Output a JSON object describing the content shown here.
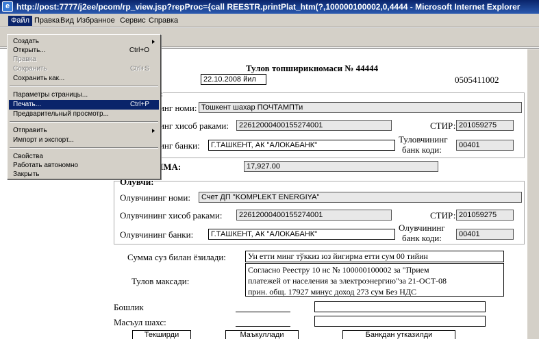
{
  "window": {
    "title": "http://post:7777/j2ee/pcom/rp_view.jsp?repProc={call REESTR.printPlat_htm(?,100000100002,0,4444 - Microsoft Internet Explorer",
    "icon": "ie-icon"
  },
  "menubar": [
    "Файл",
    "Правка",
    "Вид",
    "Избранное",
    "Сервис",
    "Справка"
  ],
  "file_menu": [
    {
      "label": "Создать",
      "shortcut": "",
      "submenu": true,
      "disabled": false
    },
    {
      "label": "Открыть...",
      "shortcut": "Ctrl+O",
      "submenu": false,
      "disabled": false
    },
    {
      "label": "Правка",
      "shortcut": "",
      "submenu": false,
      "disabled": true
    },
    {
      "label": "Сохранить",
      "shortcut": "Ctrl+S",
      "submenu": false,
      "disabled": true
    },
    {
      "label": "Сохранить как...",
      "shortcut": "",
      "submenu": false,
      "disabled": false
    },
    {
      "label": "Параметры страницы...",
      "shortcut": "",
      "submenu": false,
      "disabled": false
    },
    {
      "label": "Печать...",
      "shortcut": "Ctrl+P",
      "submenu": false,
      "disabled": false,
      "selected": true
    },
    {
      "label": "Предварительный просмотр...",
      "shortcut": "",
      "submenu": false,
      "disabled": false
    },
    {
      "label": "Отправить",
      "shortcut": "",
      "submenu": true,
      "disabled": false
    },
    {
      "label": "Импорт и экспорт...",
      "shortcut": "",
      "submenu": false,
      "disabled": false
    },
    {
      "label": "Свойства",
      "shortcut": "",
      "submenu": false,
      "disabled": false
    },
    {
      "label": "Работать автономно",
      "shortcut": "",
      "submenu": false,
      "disabled": false
    },
    {
      "label": "Закрыть",
      "shortcut": "",
      "submenu": false,
      "disabled": false
    }
  ],
  "doc": {
    "title": "Тулов топширикномаси № 44444",
    "date_tail": "а:",
    "date": "22.10.2008 йил",
    "code": "0505411002",
    "payer_head": "и:",
    "payer_name_lbl": "нинг номи:",
    "payer_name": "Тошкент шахар ПОЧТАМПТи",
    "payer_acc_lbl": "нинг хисоб раками:",
    "payer_acc": "22612000400155274001",
    "payer_inn_lbl": "СТИР:",
    "payer_inn": "201059275",
    "payer_bank_lbl": "нинг банки:",
    "payer_bank": "Г.ТАШКЕНТ, АК \"АЛОКАБАНК\"",
    "payer_bankcode_lbl1": "Туловчининг",
    "payer_bankcode_lbl2": "банк коди:",
    "payer_bankcode": "00401",
    "sum_lbl": "ММА:",
    "sum": "17,927.00",
    "recv_head": "Олувчи:",
    "recv_name_lbl": "Олувчининг номи:",
    "recv_name": "Счет ДП \"KOMPLEKT ENERGIYA\"",
    "recv_acc_lbl": "Олувчининг хисоб раками:",
    "recv_acc": "22612000400155274001",
    "recv_inn_lbl": "СТИР:",
    "recv_inn": "201059275",
    "recv_bank_lbl": "Олувчининг банки:",
    "recv_bank": "Г.ТАШКЕНТ, АК \"АЛОКАБАНК\"",
    "recv_bankcode_lbl1": "Олувчининг",
    "recv_bankcode_lbl2": "банк коди:",
    "recv_bankcode": "00401",
    "words_lbl": "Сумма суз билан ёзилади:",
    "words": "Ун етти минг тўккиз юз йигирма етти сум 00 тийин",
    "purpose_lbl": "Тулов максади:",
    "purpose_lines": [
      "Согласно Реестру 10 нс № 100000100002 за \"Прием",
      "платежей от населения за электроэнергию\"за 21-ОСТ-08",
      "прин. общ. 17927 минус доход 273 сум Без НДС"
    ],
    "chief_lbl": "Бошлик",
    "resp_lbl": "Масъул шахс:",
    "buttons": [
      "Текширди",
      "Маъкуллади",
      "Банкдан утказилди"
    ]
  }
}
